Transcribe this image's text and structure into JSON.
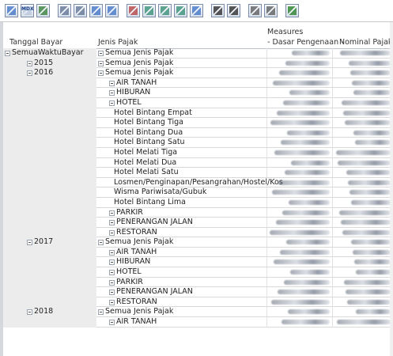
{
  "toolbar": {
    "buttons": [
      {
        "icon": "grid-icon"
      },
      {
        "icon": "mdx-icon",
        "text": "MDX"
      },
      {
        "icon": "sort-icon"
      },
      {
        "icon": "layout-icon"
      },
      {
        "icon": "layout-alt-icon"
      },
      {
        "icon": "table-icon"
      },
      {
        "icon": "table-alt-icon"
      },
      {
        "icon": "swap-axes-icon"
      },
      {
        "icon": "chart-icon"
      },
      {
        "icon": "chart-alt-icon"
      },
      {
        "icon": "chart-line-icon"
      },
      {
        "icon": "drill-icon"
      },
      {
        "icon": "bar-chart-icon"
      },
      {
        "icon": "bar-chart-alt-icon"
      },
      {
        "icon": "print-icon"
      },
      {
        "icon": "export-pdf-icon"
      },
      {
        "icon": "export-excel-icon"
      }
    ]
  },
  "header": {
    "measures": "Measures",
    "col_tanggal": "Tanggal Bayar",
    "col_jenis": "Jenis Pajak",
    "col_dasar": "- Dasar Pengenaan -",
    "col_nominal": "Nominal Pajak"
  },
  "rows": [
    {
      "c1": "SemuaWaktuBayar",
      "c1_exp": true,
      "c2": "Semua Jenis Pajak",
      "c2_level": 0,
      "c2_exp": true
    },
    {
      "c1": "2015",
      "c1_exp": true,
      "c1_level": 1,
      "c2": "Semua Jenis Pajak",
      "c2_level": 0,
      "c2_exp": true
    },
    {
      "c1": "2016",
      "c1_exp": true,
      "c1_level": 1,
      "c2": "Semua Jenis Pajak",
      "c2_level": 0,
      "c2_exp": true
    },
    {
      "c2": "AIR TANAH",
      "c2_level": 1,
      "c2_exp": true
    },
    {
      "c2": "HIBURAN",
      "c2_level": 1,
      "c2_exp": true
    },
    {
      "c2": "HOTEL",
      "c2_level": 1,
      "c2_exp": true
    },
    {
      "c2": "Hotel Bintang Empat",
      "c2_level": 2
    },
    {
      "c2": "Hotel Bintang Tiga",
      "c2_level": 2
    },
    {
      "c2": "Hotel Bintang Dua",
      "c2_level": 2
    },
    {
      "c2": "Hotel Bintang Satu",
      "c2_level": 2
    },
    {
      "c2": "Hotel Melati Tiga",
      "c2_level": 2
    },
    {
      "c2": "Hotel Melati Dua",
      "c2_level": 2
    },
    {
      "c2": "Hotel Melati Satu",
      "c2_level": 2
    },
    {
      "c2": "Losmen/Penginapan/Pesangrahan/Hostel/Kos",
      "c2_level": 2
    },
    {
      "c2": "Wisma Pariwisata/Gubuk",
      "c2_level": 2
    },
    {
      "c2": "Hotel Bintang Lima",
      "c2_level": 2
    },
    {
      "c2": "PARKIR",
      "c2_level": 1,
      "c2_exp": true
    },
    {
      "c2": "PENERANGAN JALAN",
      "c2_level": 1,
      "c2_exp": true
    },
    {
      "c2": "RESTORAN",
      "c2_level": 1,
      "c2_exp": true
    },
    {
      "c1": "2017",
      "c1_exp": true,
      "c1_level": 1,
      "c2": "Semua Jenis Pajak",
      "c2_level": 0,
      "c2_exp": true
    },
    {
      "c2": "AIR TANAH",
      "c2_level": 1,
      "c2_exp": true
    },
    {
      "c2": "HIBURAN",
      "c2_level": 1,
      "c2_exp": true
    },
    {
      "c2": "HOTEL",
      "c2_level": 1,
      "c2_exp": true
    },
    {
      "c2": "PARKIR",
      "c2_level": 1,
      "c2_exp": true
    },
    {
      "c2": "PENERANGAN JALAN",
      "c2_level": 1,
      "c2_exp": true
    },
    {
      "c2": "RESTORAN",
      "c2_level": 1,
      "c2_exp": true
    },
    {
      "c1": "2018",
      "c1_exp": true,
      "c1_level": 1,
      "c2": "Semua Jenis Pajak",
      "c2_level": 0,
      "c2_exp": true
    },
    {
      "c2": "AIR TANAH",
      "c2_level": 1,
      "c2_exp": true
    }
  ]
}
